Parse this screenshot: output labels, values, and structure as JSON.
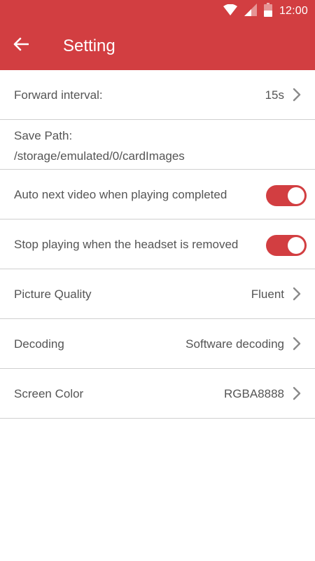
{
  "status_bar": {
    "time": "12:00",
    "icons": [
      "wifi-icon",
      "signal-icon",
      "battery-icon"
    ]
  },
  "colors": {
    "accent": "#D23E41",
    "text": "#555555",
    "divider": "#D0D0D0",
    "background": "#FFFFFF"
  },
  "toolbar": {
    "back_icon": "arrow-left-icon",
    "title": "Setting"
  },
  "settings": {
    "forward_interval": {
      "label": "Forward interval:",
      "value": "15s"
    },
    "save_path": {
      "label": "Save Path:",
      "value": "/storage/emulated/0/cardImages"
    },
    "auto_next": {
      "label": "Auto next video when playing completed",
      "enabled": true
    },
    "stop_headset": {
      "label": "Stop playing when the headset is removed",
      "enabled": true
    },
    "picture_quality": {
      "label": "Picture Quality",
      "value": "Fluent"
    },
    "decoding": {
      "label": "Decoding",
      "value": "Software decoding"
    },
    "screen_color": {
      "label": "Screen Color",
      "value": "RGBA8888"
    }
  }
}
